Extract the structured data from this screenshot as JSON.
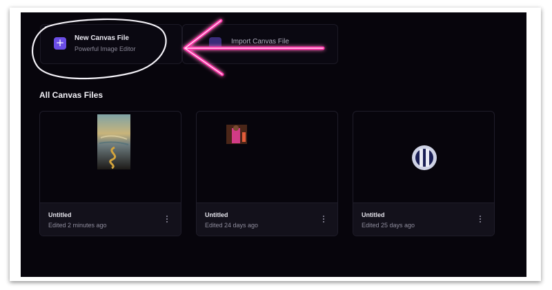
{
  "top_actions": {
    "new_canvas": {
      "title": "New Canvas File",
      "subtitle": "Powerful Image Editor",
      "icon": "plus-icon"
    },
    "import_canvas": {
      "title": "Import Canvas File",
      "icon": "import-icon"
    }
  },
  "section": {
    "title": "All Canvas Files"
  },
  "files": [
    {
      "name": "Untitled",
      "edited": "Edited 2 minutes ago",
      "thumbnail": "landscape-sunset-thumbnail"
    },
    {
      "name": "Untitled",
      "edited": "Edited 24 days ago",
      "thumbnail": "person-photo-thumbnail"
    },
    {
      "name": "Untitled",
      "edited": "Edited 25 days ago",
      "thumbnail": "logo-thumbnail"
    }
  ],
  "annotation": {
    "color": "#ff2fa8",
    "shapes": [
      "hand-drawn-ellipse",
      "arrow-left"
    ]
  },
  "colors": {
    "accent": "#6b4ee6",
    "background": "#07050c",
    "card_footer": "#13111b"
  }
}
